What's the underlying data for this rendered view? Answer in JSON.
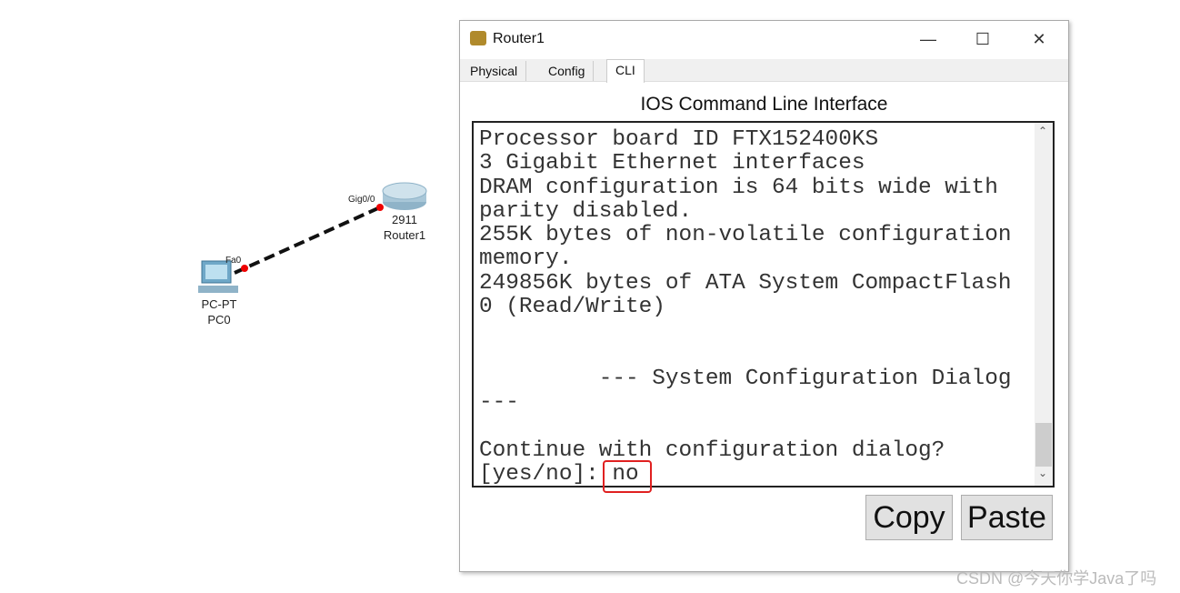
{
  "topology": {
    "pc": {
      "type": "PC-PT",
      "name": "PC0",
      "port": "Fa0"
    },
    "router": {
      "model": "2911",
      "name": "Router1",
      "port": "Gig0/0"
    },
    "link_color": "#111111",
    "port_dot_color": "#e00000"
  },
  "window": {
    "title": "Router1",
    "controls": {
      "minimize": "—",
      "maximize": "☐",
      "close": "✕"
    },
    "tabs": [
      {
        "label": "Physical"
      },
      {
        "label": "Config"
      },
      {
        "label": "CLI",
        "active": true
      }
    ],
    "heading": "IOS Command Line Interface",
    "terminal_lines": [
      "Processor board ID FTX152400KS",
      "3 Gigabit Ethernet interfaces",
      "DRAM configuration is 64 bits wide with",
      "parity disabled.",
      "255K bytes of non-volatile configuration",
      "memory.",
      "249856K bytes of ATA System CompactFlash",
      "0 (Read/Write)",
      "",
      "",
      "         --- System Configuration Dialog",
      "---",
      "",
      "Continue with configuration dialog?",
      "[yes/no]: no"
    ],
    "copy_label": "Copy",
    "paste_label": "Paste",
    "highlight_color": "#e02020"
  },
  "watermark": "CSDN @今天你学Java了吗"
}
